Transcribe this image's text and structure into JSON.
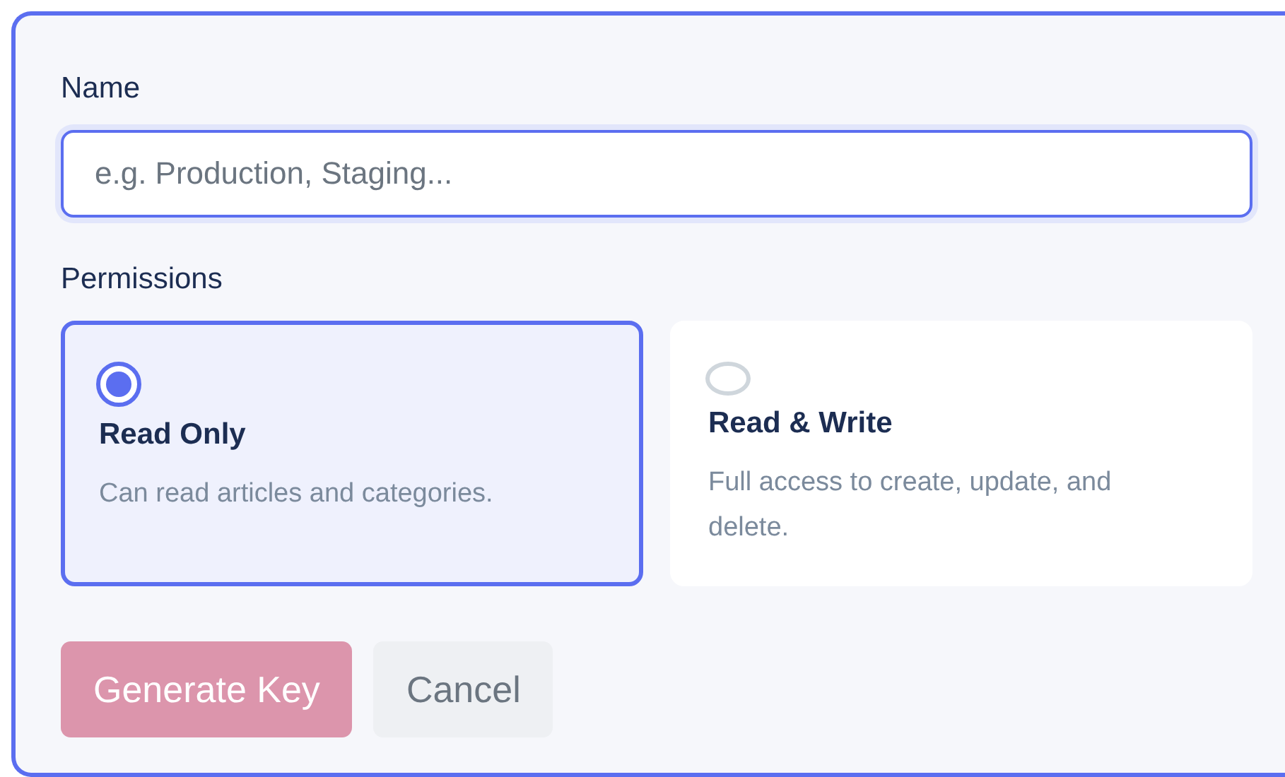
{
  "name_field": {
    "label": "Name",
    "placeholder": "e.g. Production, Staging..."
  },
  "permissions": {
    "label": "Permissions",
    "options": [
      {
        "title": "Read Only",
        "description": "Can read articles and categories.",
        "selected": true
      },
      {
        "title": "Read & Write",
        "description": "Full access to create, update, and delete.",
        "selected": false
      }
    ]
  },
  "buttons": [
    {
      "kind": "primary",
      "label": "Generate Key",
      "disabled": true
    },
    {
      "kind": "secondary",
      "label": "Cancel",
      "disabled": false
    }
  ]
}
